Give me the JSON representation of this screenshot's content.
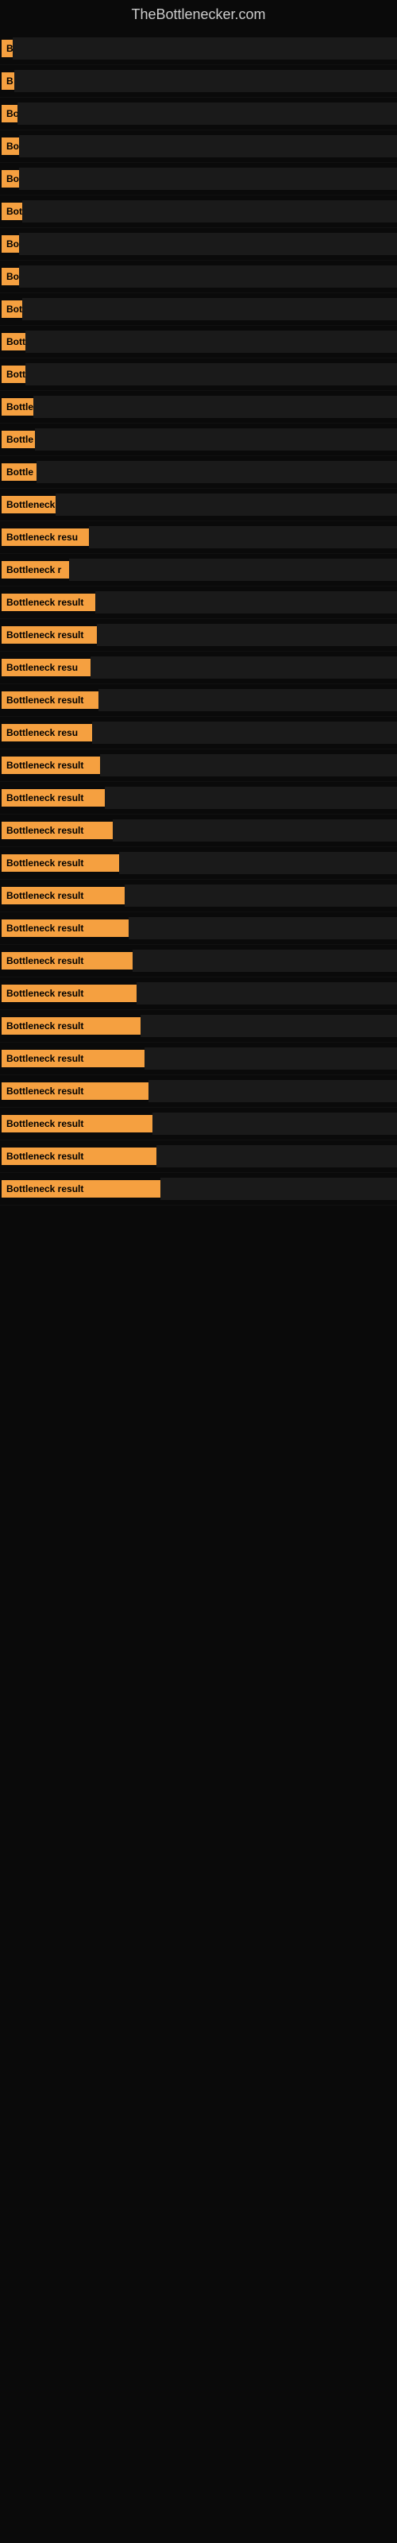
{
  "site": {
    "title": "TheBottlenecker.com"
  },
  "items": [
    {
      "label": "B",
      "labelWidth": 14
    },
    {
      "label": "B",
      "labelWidth": 16
    },
    {
      "label": "Bo",
      "labelWidth": 20
    },
    {
      "label": "Bo",
      "labelWidth": 22
    },
    {
      "label": "Bo",
      "labelWidth": 22
    },
    {
      "label": "Bot",
      "labelWidth": 26
    },
    {
      "label": "Bo",
      "labelWidth": 22
    },
    {
      "label": "Bo",
      "labelWidth": 22
    },
    {
      "label": "Bot",
      "labelWidth": 26
    },
    {
      "label": "Bott",
      "labelWidth": 30
    },
    {
      "label": "Bott",
      "labelWidth": 30
    },
    {
      "label": "Bottle",
      "labelWidth": 40
    },
    {
      "label": "Bottle",
      "labelWidth": 42
    },
    {
      "label": "Bottle",
      "labelWidth": 44
    },
    {
      "label": "Bottleneck",
      "labelWidth": 68
    },
    {
      "label": "Bottleneck resu",
      "labelWidth": 110
    },
    {
      "label": "Bottleneck r",
      "labelWidth": 85
    },
    {
      "label": "Bottleneck result",
      "labelWidth": 118
    },
    {
      "label": "Bottleneck result",
      "labelWidth": 120
    },
    {
      "label": "Bottleneck resu",
      "labelWidth": 112
    },
    {
      "label": "Bottleneck result",
      "labelWidth": 122
    },
    {
      "label": "Bottleneck resu",
      "labelWidth": 114
    },
    {
      "label": "Bottleneck result",
      "labelWidth": 124
    },
    {
      "label": "Bottleneck result",
      "labelWidth": 130
    },
    {
      "label": "Bottleneck result",
      "labelWidth": 140
    },
    {
      "label": "Bottleneck result",
      "labelWidth": 148
    },
    {
      "label": "Bottleneck result",
      "labelWidth": 155
    },
    {
      "label": "Bottleneck result",
      "labelWidth": 160
    },
    {
      "label": "Bottleneck result",
      "labelWidth": 165
    },
    {
      "label": "Bottleneck result",
      "labelWidth": 170
    },
    {
      "label": "Bottleneck result",
      "labelWidth": 175
    },
    {
      "label": "Bottleneck result",
      "labelWidth": 180
    },
    {
      "label": "Bottleneck result",
      "labelWidth": 185
    },
    {
      "label": "Bottleneck result",
      "labelWidth": 190
    },
    {
      "label": "Bottleneck result",
      "labelWidth": 195
    },
    {
      "label": "Bottleneck result",
      "labelWidth": 200
    }
  ]
}
